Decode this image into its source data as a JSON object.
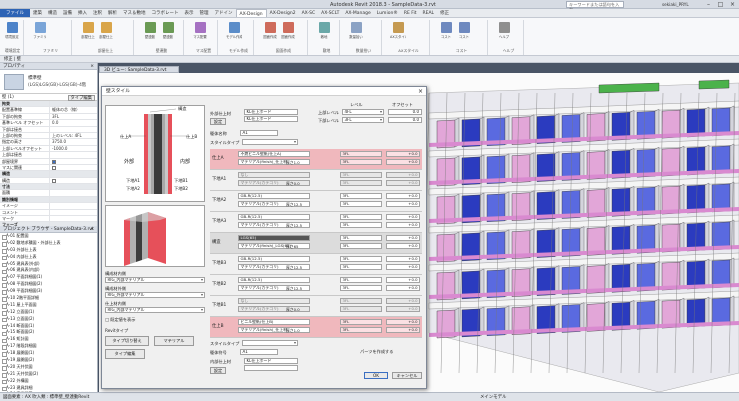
{
  "window": {
    "title": "Autodesk Revit 2018.3 - SampleData-3.rvt",
    "search_placeholder": "キーワードまたは語句を入力",
    "user": "sekiaki_PRYL"
  },
  "ribbon_tabs": [
    "ファイル",
    "建築",
    "構造",
    "設備",
    "挿入",
    "注釈",
    "解析",
    "マス＆敷地",
    "コラボレート",
    "表示",
    "管理",
    "アドイン",
    "AX-Design",
    "AX-Design2",
    "AX-SC",
    "AX-SCLT",
    "AX-Manage",
    "Lumion®",
    "RE Fit",
    "REAL",
    "修正"
  ],
  "ribbon_groups": [
    {
      "label": "環境設定",
      "buttons": [
        "環境設定"
      ]
    },
    {
      "label": "ファミリ",
      "buttons": [
        "ファミリ"
      ]
    },
    {
      "label": "部屋仕上",
      "buttons": [
        "部屋仕上",
        "部屋仕上"
      ]
    },
    {
      "label": "壁連動",
      "buttons": [
        "壁連動",
        "壁連動"
      ]
    },
    {
      "label": "マス配置",
      "buttons": [
        "マス配置"
      ]
    },
    {
      "label": "モデル作成",
      "buttons": [
        "モデル作成"
      ]
    },
    {
      "label": "図面作成",
      "buttons": [
        "図面作成",
        "図面作成"
      ]
    },
    {
      "label": "敷地",
      "buttons": [
        "敷地"
      ]
    },
    {
      "label": "数量拾い",
      "buttons": [
        "数量拾い"
      ]
    },
    {
      "label": "AXスタイル",
      "buttons": [
        "AXスタイル"
      ]
    },
    {
      "label": "コスト",
      "buttons": [
        "コスト",
        "コスト"
      ]
    },
    {
      "label": "ヘルプ",
      "buttons": [
        "ヘルプ"
      ]
    }
  ],
  "optionbar": {
    "text": "修正 | 壁"
  },
  "properties": {
    "title": "プロパティ",
    "type_name": "標準壁",
    "type_sub": "(LGS)LGS(GB)-LGS(GB)-4階",
    "filter": "壁 (1)",
    "edit_type": "タイプ編集",
    "rows": [
      {
        "k": "拘束",
        "v": "",
        "cat": true
      },
      {
        "k": "配置基準線",
        "v": "躯体の芯（線）"
      },
      {
        "k": "下部の拘束",
        "v": "3FL"
      },
      {
        "k": "基準レベル オフセット",
        "v": "0.0"
      },
      {
        "k": "下部は接合",
        "v": ""
      },
      {
        "k": "上部の拘束",
        "v": "上のレベル: 4FL"
      },
      {
        "k": "指定の高さ",
        "v": "3750.0"
      },
      {
        "k": "上部レベルオフセット",
        "v": "-1000.0"
      },
      {
        "k": "上部は接合",
        "v": ""
      },
      {
        "k": "部屋境界",
        "v": "",
        "check": true
      },
      {
        "k": "マスに関連",
        "v": "",
        "check": false
      },
      {
        "k": "構造",
        "v": "",
        "cat": true
      },
      {
        "k": "構造",
        "v": "",
        "check": false
      },
      {
        "k": "寸法",
        "v": "",
        "cat": true
      },
      {
        "k": "面積",
        "v": ""
      },
      {
        "k": "識別情報",
        "v": "",
        "cat": true
      },
      {
        "k": "イメージ",
        "v": ""
      },
      {
        "k": "コメント",
        "v": ""
      },
      {
        "k": "マーク",
        "v": ""
      },
      {
        "k": "フェーズ",
        "v": "",
        "cat": true
      },
      {
        "k": "構築フェーズ",
        "v": "新しい施工"
      },
      {
        "k": "解体フェーズ",
        "v": "なし"
      }
    ],
    "help": "プロパティ ヘルプ",
    "apply": "適用"
  },
  "browser": {
    "title": "プロジェクト ブラウザ - SampleData-3.rvt",
    "items": [
      "A-01 配置図",
      "A-02 敷地求積図・外部仕上表",
      "A-03 外部仕上表",
      "A-04 内部仕上表",
      "A-05 建具表(外部)",
      "A-06 建具表(内部)",
      "A-07 平面詳細図(1)",
      "A-08 平面詳細図(2)",
      "A-09 平面詳細図(3)",
      "A-10 2階平面詳細",
      "A-11 屋上平面図",
      "A-12 立面図(1)",
      "A-13 立面図(2)",
      "A-14 断面図(1)",
      "A-15 断面図(2)",
      "A-16 矩計図",
      "A-17 階段詳細図",
      "A-18 展開図(1)",
      "A-19 展開図(2)",
      "A-20 天井伏図",
      "A-21 天井伏図(2)",
      "A-22 外構図",
      "A-23 建具詳細",
      "A-24 家具配置",
      "A-25 設備図",
      "ファミリ"
    ]
  },
  "view_tab": "3D ビュー: SampleData-3.rvt",
  "status": {
    "left": "図面要素 : AX 吹入類 : 標準壁_壁連動Revit",
    "center": "メインモデル"
  },
  "dialog": {
    "title": "壁スタイル",
    "preview_labels": {
      "outer": "外部",
      "inner": "内部",
      "top": "構造",
      "finish_out": "仕上A",
      "finish_in": "仕上B",
      "base_out": "下地A1",
      "base_in": "下地B1",
      "base_out2": "下地A2",
      "base_in2": "下地B2"
    },
    "outer_label": "外部仕上材",
    "outer_value": "KL仕上ボード",
    "outer_value2": "KL仕上ボード",
    "finish_label": "仕上材選択",
    "finish_btn": "設定",
    "levels_header": "レベル",
    "offset_header": "オフセット",
    "top_level_label": "上部レベル",
    "bottom_level_label": "下部レベル",
    "top_level": "4FL",
    "bottom_level": "3FL",
    "top_offset": "0.0",
    "bottom_offset": "0.0",
    "wall_name_label": "躯体名称",
    "wall_name": "A1",
    "style_label": "スタイルタイプ",
    "style_value": "",
    "layers": [
      {
        "name": "仕上A",
        "hl": true,
        "f1": "不燃ビニル壁紙(仕上A)",
        "f2": "マテリアル(finish)_仕上材",
        "thick": "厚さ1.0",
        "lvl1": "3FL",
        "lvl2": "3FL",
        "off1": "+0.0",
        "off2": "+0.0"
      },
      {
        "name": "下地A1",
        "f1": "なし",
        "f2": "マテリアル(カテゴリ)",
        "thick": "厚さ0.0",
        "lvl1": "3FL",
        "lvl2": "3FL",
        "off1": "+0.0",
        "off2": "+0.0",
        "dis": true
      },
      {
        "name": "下地A2",
        "f1": "GB-R(12.5)",
        "f2": "マテリアル(カテゴリ)",
        "thick": "厚さ12.5",
        "lvl1": "3FL",
        "lvl2": "3FL",
        "off1": "+0.0",
        "off2": "+0.0"
      },
      {
        "name": "下地A3",
        "f1": "GB-R(12.5)",
        "f2": "マテリアル(カテゴリ)",
        "thick": "厚さ12.5",
        "lvl1": "3FL",
        "lvl2": "3FL",
        "off1": "+0.0",
        "off2": "+0.0"
      },
      {
        "name": "構造",
        "f1": "LGS(65)",
        "f2": "マテリアル(finish)_LGS(65)",
        "thick": "厚さ65",
        "lvl1": "3FL",
        "lvl2": "3FL",
        "off1": "+0.0",
        "off2": "+0.0",
        "struct": true
      },
      {
        "name": "下地B3",
        "f1": "GB-R(12.5)",
        "f2": "マテリアル(カテゴリ)",
        "thick": "厚さ12.5",
        "lvl1": "3FL",
        "lvl2": "3FL",
        "off1": "+0.0",
        "off2": "+0.0"
      },
      {
        "name": "下地B2",
        "f1": "GB-R(12.5)",
        "f2": "マテリアル(カテゴリ)",
        "thick": "厚さ12.5",
        "lvl1": "3FL",
        "lvl2": "3FL",
        "off1": "+0.0",
        "off2": "+0.0"
      },
      {
        "name": "下地B1",
        "f1": "なし",
        "f2": "マテリアル(カテゴリ)",
        "thick": "厚さ0.0",
        "lvl1": "3FL",
        "lvl2": "3FL",
        "off1": "+0.0",
        "off2": "+0.0",
        "dis": true
      },
      {
        "name": "仕上B",
        "hl": true,
        "f1": "ビニル壁紙(仕上B)",
        "f2": "マテリアル(finish)_仕上材",
        "thick": "厚さ1.0",
        "lvl1": "3FL",
        "lvl2": "3FL",
        "off1": "+0.0",
        "off2": "+0.0"
      }
    ],
    "left_rows": [
      {
        "label": "構成材内側",
        "value": "RIG_内部マテリアル"
      },
      {
        "label": "構成材外側",
        "value": "RIG_外部マテリアル"
      },
      {
        "label": "仕上材内側",
        "value": "RIG_内部マテリアル"
      }
    ],
    "left_note": "□ 既定値を表示",
    "revit_type_label": "Revitタイプ",
    "btn_type_cut": "タイプ切り替え",
    "btn_material": "マテリアル",
    "btn_type_edit": "タイプ編集",
    "inner_label": "内部仕上材",
    "inner_value": "KL仕上ボード",
    "wall_no_label": "躯体符号",
    "wall_no": "A1",
    "style_label2": "スタイルタイプ",
    "chk_finish": "パーツを作成する",
    "ok": "OK",
    "cancel": "キャンセル"
  }
}
